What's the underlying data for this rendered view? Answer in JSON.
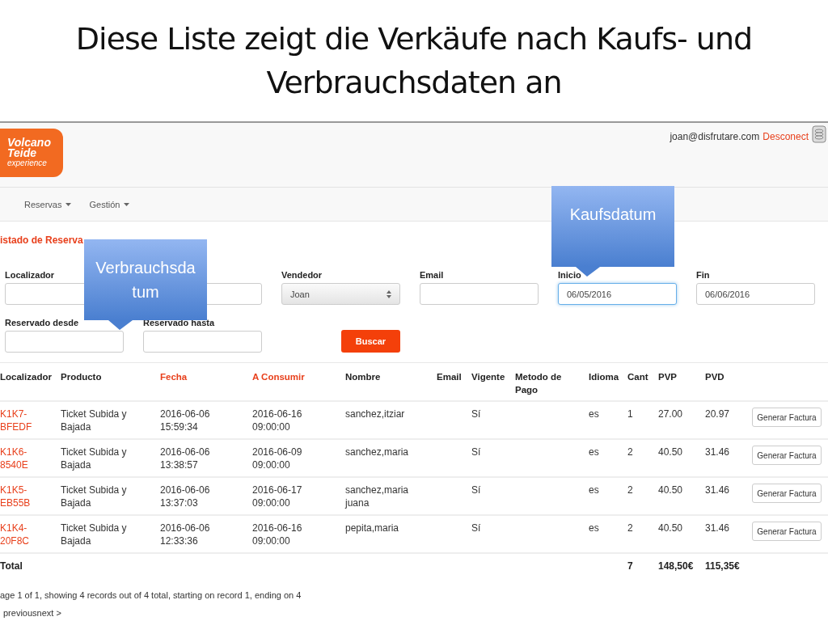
{
  "slide_title": "Diese Liste zeigt die Verkäufe nach Kaufs- und Verbrauchsdaten an",
  "header": {
    "logo": [
      "Volcano",
      "Teide",
      "experience"
    ],
    "user": "joan@disfrutare.com",
    "logout": "Desconect"
  },
  "nav": [
    {
      "label": "Reservas"
    },
    {
      "label": "Gestión"
    }
  ],
  "section_title": "istado de Reserva",
  "filters": [
    {
      "kind": "text",
      "label": "Localizador",
      "focused": false
    },
    {
      "kind": "text",
      "focused": false
    },
    {
      "kind": "select",
      "label": "Vendedor",
      "value": "Joan",
      "focused": false
    },
    {
      "kind": "text",
      "label": "Email",
      "focused": false
    },
    {
      "kind": "text",
      "label": "Inicio",
      "value": "06/05/2016",
      "focused": true
    },
    {
      "kind": "text",
      "label": "Fin",
      "value": "06/06/2016",
      "focused": false
    },
    {
      "kind": "text",
      "label": "Reservado desde",
      "focused": false
    },
    {
      "kind": "text",
      "label": "Reservado hasta",
      "focused": false
    },
    {
      "kind": "button",
      "label": "Buscar"
    }
  ],
  "table": {
    "columns": [
      {
        "label": "Localizador",
        "sorted": false
      },
      {
        "label": "Producto",
        "sorted": false
      },
      {
        "label": "Fecha",
        "sorted": true
      },
      {
        "label": "A Consumir",
        "sorted": true
      },
      {
        "label": "Nombre",
        "sorted": false
      },
      {
        "label": "Email",
        "sorted": false
      },
      {
        "label": "Vigente",
        "sorted": false
      },
      {
        "label": "Metodo de Pago",
        "sorted": false
      },
      {
        "label": "Idioma",
        "sorted": false
      },
      {
        "label": "Cant",
        "sorted": false
      },
      {
        "label": "PVP",
        "sorted": false
      },
      {
        "label": "PVD",
        "sorted": false
      }
    ],
    "rows": [
      {
        "localizador": "K1K7-BFEDF",
        "producto": "Ticket Subida y Bajada",
        "fecha": "2016-06-06 15:59:34",
        "a_consumir": "2016-06-16 09:00:00",
        "nombre": "sanchez,itziar",
        "vigente": "Sí",
        "idioma": "es",
        "cant": "1",
        "pvp": "27.00",
        "pvd": "20.97",
        "action": "Generar Factura"
      },
      {
        "localizador": "K1K6-8540E",
        "producto": "Ticket Subida y Bajada",
        "fecha": "2016-06-06 13:38:57",
        "a_consumir": "2016-06-09 09:00:00",
        "nombre": "sanchez,maria",
        "vigente": "Sí",
        "idioma": "es",
        "cant": "2",
        "pvp": "40.50",
        "pvd": "31.46",
        "action": "Generar Factura"
      },
      {
        "localizador": "K1K5-EB55B",
        "producto": "Ticket Subida y Bajada",
        "fecha": "2016-06-06 13:37:03",
        "a_consumir": "2016-06-17 09:00:00",
        "nombre": "sanchez,maria juana",
        "vigente": "Sí",
        "idioma": "es",
        "cant": "2",
        "pvp": "40.50",
        "pvd": "31.46",
        "action": "Generar Factura"
      },
      {
        "localizador": "K1K4-20F8C",
        "producto": "Ticket Subida y Bajada",
        "fecha": "2016-06-06 12:33:36",
        "a_consumir": "2016-06-16 09:00:00",
        "nombre": "pepita,maria",
        "vigente": "Sí",
        "idioma": "es",
        "cant": "2",
        "pvp": "40.50",
        "pvd": "31.46",
        "action": "Generar Factura"
      }
    ],
    "total": {
      "label": "Total",
      "cant": "7",
      "pvp": "148,50€",
      "pvd": "115,35€"
    }
  },
  "pagination": "age 1 of 1, showing 4 records out of 4 total, starting on record 1, ending on 4",
  "pager": "previousnext >",
  "callouts": [
    {
      "text": "Kaufsdatum"
    },
    {
      "text": "Verbrauchsdatum"
    }
  ]
}
